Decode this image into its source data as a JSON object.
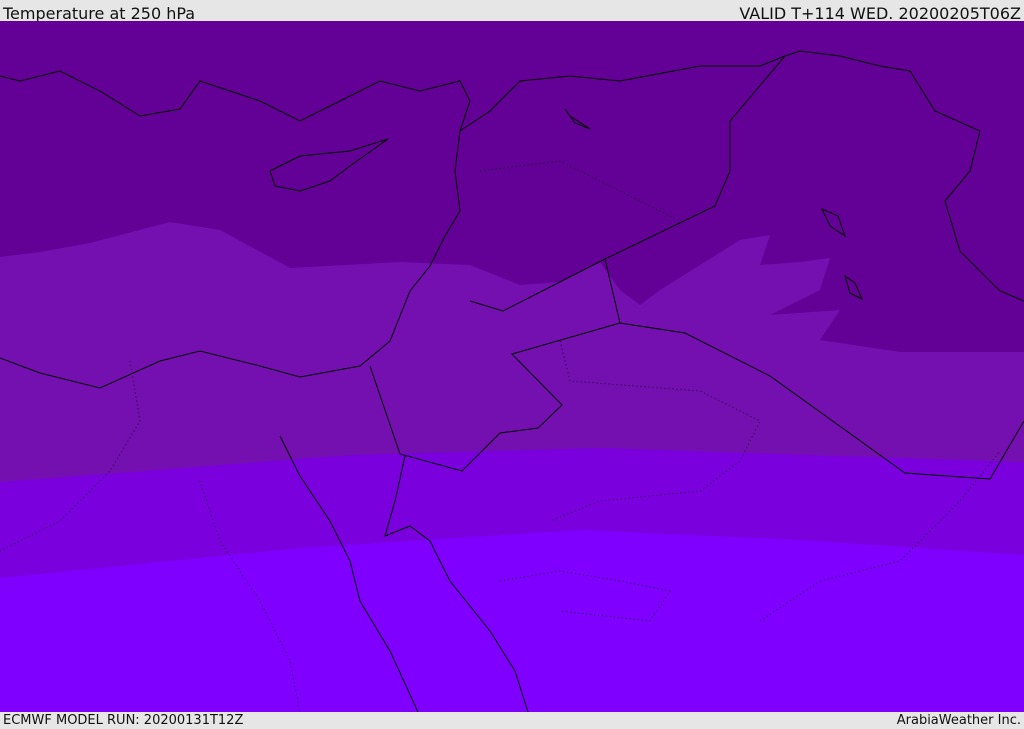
{
  "header": {
    "title": "Temperature at 250 hPa",
    "valid": "VALID T+114 WED. 20200205T06Z"
  },
  "footer": {
    "model_run": "ECMWF MODEL RUN: 20200131T12Z",
    "credit": "ArabiaWeather Inc."
  },
  "map": {
    "bands": [
      {
        "color": "#630096"
      },
      {
        "color": "#7410b0"
      },
      {
        "color": "#7a00dd"
      },
      {
        "color": "#7f00ff"
      }
    ],
    "coast_color": "#000000"
  }
}
